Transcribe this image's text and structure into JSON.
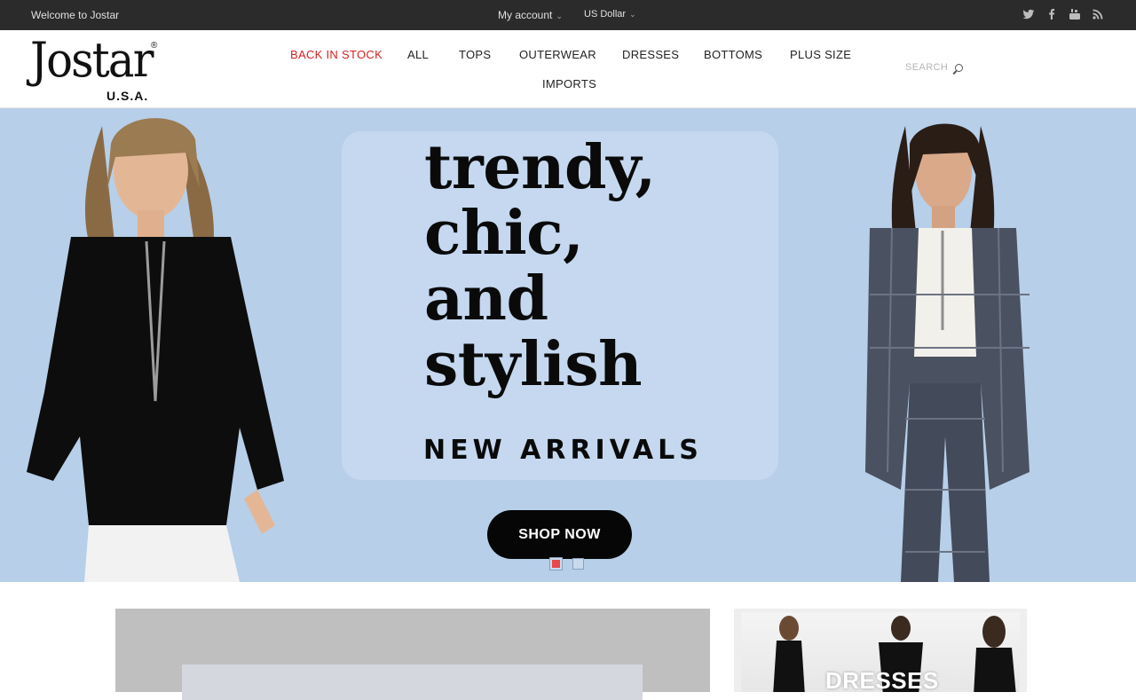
{
  "topbar": {
    "welcome": "Welcome to Jostar",
    "account_label": "My account",
    "currency_label": "US Dollar",
    "social_icons": [
      "twitter-icon",
      "facebook-icon",
      "youtube-icon",
      "rss-icon"
    ]
  },
  "logo": {
    "brand": "Jostar",
    "registered": "®",
    "subtitle": "U.S.A."
  },
  "nav": {
    "items": [
      {
        "label": "BACK IN STOCK"
      },
      {
        "label": "ALL"
      },
      {
        "label": "TOPS"
      },
      {
        "label": "OUTERWEAR"
      },
      {
        "label": "DRESSES"
      },
      {
        "label": "BOTTOMS"
      },
      {
        "label": "PLUS SIZE"
      },
      {
        "label": "IMPORTS"
      }
    ],
    "search_placeholder": "SEARCH"
  },
  "hero": {
    "headline_lines": [
      "trendy,",
      "chic,",
      "and",
      "stylish"
    ],
    "subheadline": "NEW ARRIVALS",
    "cta": "SHOP NOW",
    "slides_total": 2,
    "active_slide": 1
  },
  "lower": {
    "dresses_label": "DRESSES"
  },
  "colors": {
    "topbar_bg": "#2b2b2b",
    "nav_active": "#d81f1f",
    "hero_bg": "#b7cfe9",
    "cta_bg": "#060606",
    "slider_dot_active": "#e8474b"
  }
}
